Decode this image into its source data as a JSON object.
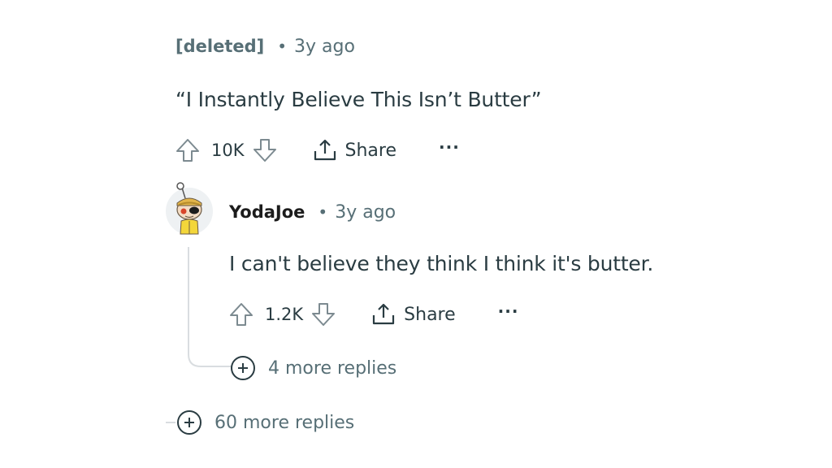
{
  "comment_top": {
    "author": "[deleted]",
    "separator": "•",
    "time": "3y ago",
    "body": "“I Instantly Believe This Isn’t Butter”",
    "votes": "10K",
    "share_label": "Share",
    "more_label": "···"
  },
  "comment_reply": {
    "author": "YodaJoe",
    "separator": "•",
    "time": "3y ago",
    "body": "I can't believe they think I think it's butter.",
    "votes": "1.2K",
    "share_label": "Share",
    "more_label": "···",
    "more_replies": "4 more replies"
  },
  "thread": {
    "more_replies": "60 more replies"
  },
  "colors": {
    "meta": "#576f76",
    "body": "#2a3c42",
    "thread_line": "#d9dde0"
  },
  "icons": {
    "upvote": "arrow-up-outline-icon",
    "downvote": "arrow-down-outline-icon",
    "share": "share-upload-icon",
    "expand": "plus-circle-icon",
    "avatar": "snoo-avatar-icon"
  }
}
